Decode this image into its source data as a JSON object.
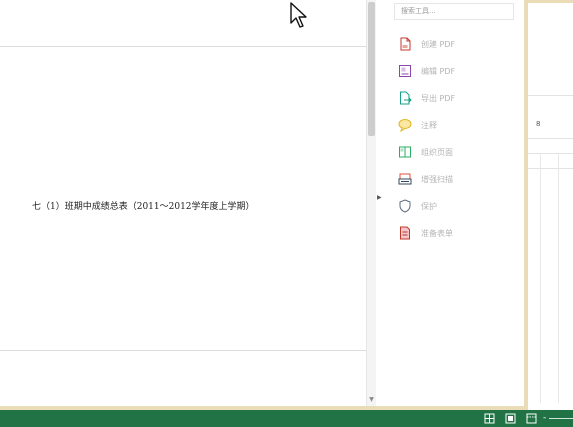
{
  "document": {
    "title": "七（1）班期中成绩总表（2011～2012学年度上学期）"
  },
  "tools_pane": {
    "search_placeholder": "搜索工具...",
    "items": [
      {
        "label": "创建 PDF",
        "icon": "create-pdf-icon",
        "color": "#c0392b"
      },
      {
        "label": "编辑 PDF",
        "icon": "edit-pdf-icon",
        "color": "#8e44ad"
      },
      {
        "label": "导出 PDF",
        "icon": "export-pdf-icon",
        "color": "#16a085"
      },
      {
        "label": "注释",
        "icon": "comment-icon",
        "color": "#f1c40f"
      },
      {
        "label": "组织页面",
        "icon": "organize-pages-icon",
        "color": "#27ae60"
      },
      {
        "label": "增强扫描",
        "icon": "enhance-scan-icon",
        "color": "#e74c3c"
      },
      {
        "label": "保护",
        "icon": "protect-shield-icon",
        "color": "#34495e"
      },
      {
        "label": "准备表单",
        "icon": "prepare-form-icon",
        "color": "#c0392b"
      }
    ]
  },
  "sheet": {
    "cell_mark": "8"
  },
  "status_bar": {
    "color": "#217346",
    "zoom_minus": "-"
  }
}
